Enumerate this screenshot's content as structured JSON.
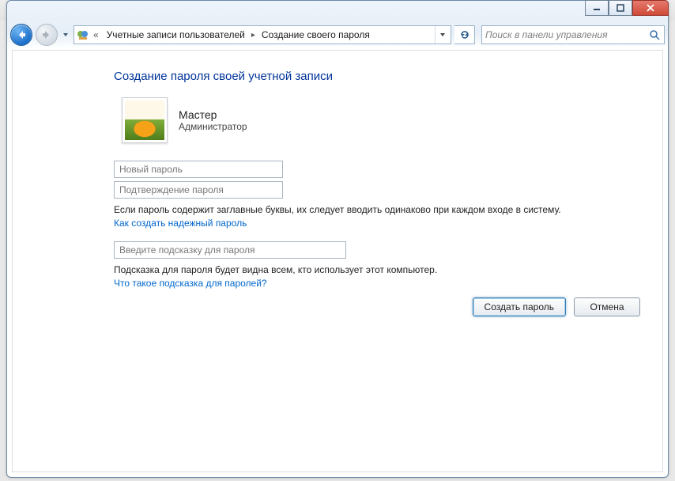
{
  "breadcrumb": {
    "seg1": "Учетные записи пользователей",
    "seg2": "Создание своего пароля"
  },
  "search": {
    "placeholder": "Поиск в панели управления"
  },
  "page": {
    "title": "Создание пароля своей учетной записи"
  },
  "user": {
    "name": "Мастер",
    "role": "Администратор"
  },
  "inputs": {
    "new_password_placeholder": "Новый пароль",
    "confirm_password_placeholder": "Подтверждение пароля",
    "hint_placeholder": "Введите подсказку для пароля"
  },
  "text": {
    "caps_note": "Если пароль содержит заглавные буквы, их следует вводить одинаково при каждом входе в систему.",
    "hint_note": "Подсказка для пароля будет видна всем, кто использует этот компьютер."
  },
  "links": {
    "strong_pw": "Как создать надежный пароль",
    "what_hint": "Что такое подсказка для паролей?"
  },
  "buttons": {
    "create": "Создать пароль",
    "cancel": "Отмена"
  }
}
